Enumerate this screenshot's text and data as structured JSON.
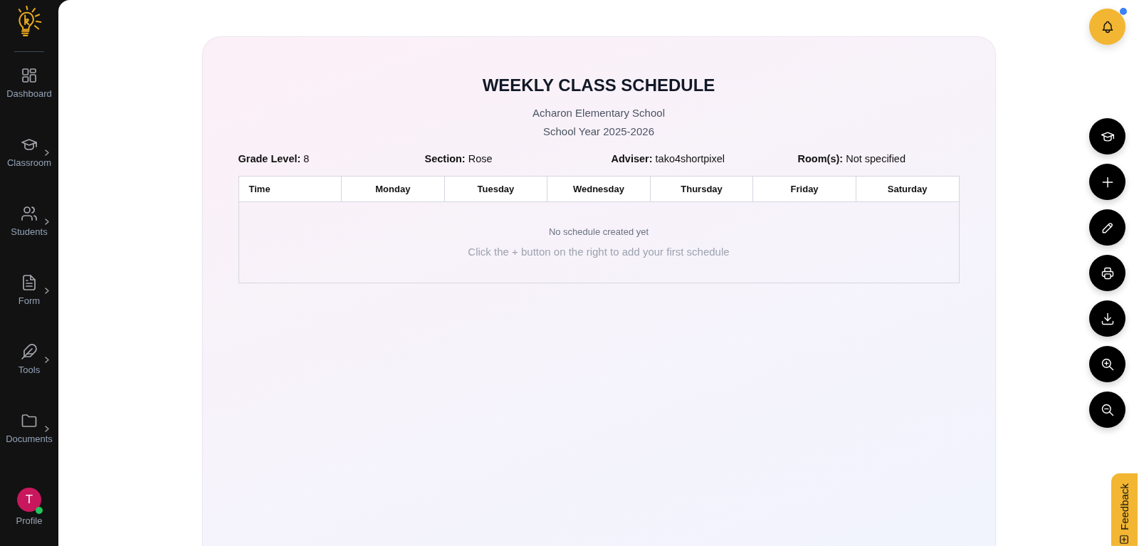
{
  "sidebar": {
    "items": [
      {
        "label": "Dashboard",
        "kind": "dashboard",
        "submenu": false
      },
      {
        "label": "Classroom",
        "kind": "classroom",
        "submenu": true
      },
      {
        "label": "Students",
        "kind": "students",
        "submenu": true
      },
      {
        "label": "Form",
        "kind": "form",
        "submenu": true
      },
      {
        "label": "Tools",
        "kind": "tools",
        "submenu": true
      },
      {
        "label": "Documents",
        "kind": "documents",
        "submenu": true
      }
    ],
    "profile": {
      "initial": "T",
      "label": "Profile",
      "online": true
    }
  },
  "notification_button": {
    "unread": true
  },
  "schedule": {
    "title": "WEEKLY CLASS SCHEDULE",
    "school": "Acharon Elementary School",
    "school_year": "School Year 2025-2026",
    "details": [
      {
        "label": "Grade Level:",
        "value": "8"
      },
      {
        "label": "Section:",
        "value": "Rose"
      },
      {
        "label": "Adviser:",
        "value": "tako4shortpixel"
      },
      {
        "label": "Room(s):",
        "value": "Not specified"
      }
    ],
    "table": {
      "columns": [
        "Time",
        "Monday",
        "Tuesday",
        "Wednesday",
        "Thursday",
        "Friday",
        "Saturday"
      ],
      "empty_title": "No schedule created yet",
      "empty_hint": "Click the + button on the right to add your first schedule"
    }
  },
  "action_buttons": [
    {
      "kind": "class"
    },
    {
      "kind": "add"
    },
    {
      "kind": "edit"
    },
    {
      "kind": "print"
    },
    {
      "kind": "download"
    },
    {
      "kind": "zoom-in"
    },
    {
      "kind": "zoom-out"
    }
  ],
  "feedback_tab": {
    "label": "Feedback"
  }
}
